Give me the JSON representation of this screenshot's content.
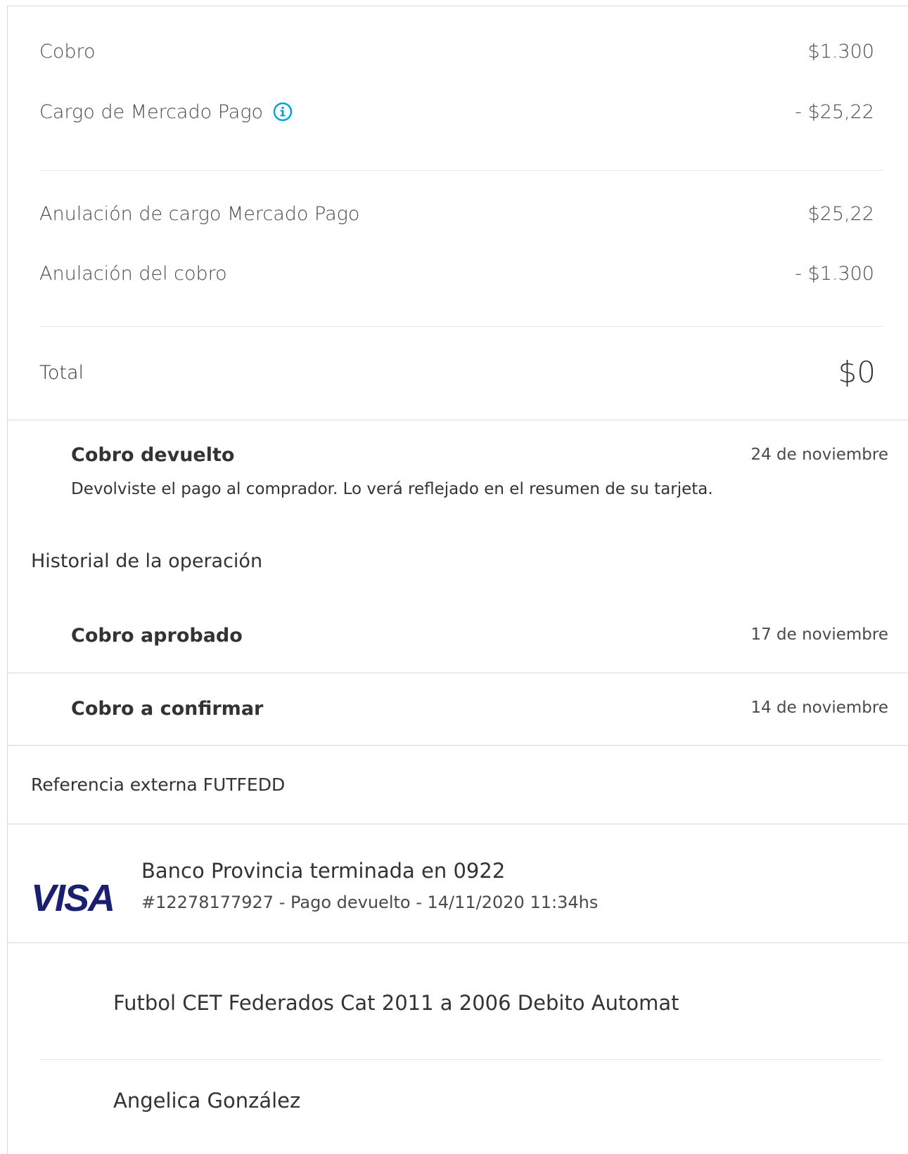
{
  "summary": {
    "rows": [
      {
        "label": "Cobro",
        "amount": "$1.300"
      },
      {
        "label": "Cargo de Mercado Pago",
        "amount": "- $25,22"
      },
      {
        "label": "Anulación de cargo Mercado Pago",
        "amount": "$25,22"
      },
      {
        "label": "Anulación del cobro",
        "amount": "- $1.300"
      }
    ],
    "total_label": "Total",
    "total_amount": "$0"
  },
  "status": {
    "title": "Cobro devuelto",
    "date": "24 de noviembre",
    "description": "Devolviste el pago al comprador. Lo verá reflejado en el resumen de su tarjeta."
  },
  "history": {
    "heading": "Historial de la operación",
    "items": [
      {
        "title": "Cobro aprobado",
        "date": "17 de noviembre"
      },
      {
        "title": "Cobro a confirmar",
        "date": "14 de noviembre"
      }
    ]
  },
  "reference": {
    "text": "Referencia externa FUTFEDD"
  },
  "payment_method": {
    "brand_icon": "visa-logo",
    "card_text": "Banco Provincia terminada en 0922",
    "detail_text": "#12278177927 - Pago devuelto - 14/11/2020 11:34hs"
  },
  "details": {
    "description": "Futbol CET Federados Cat 2011 a 2006 Debito Automat",
    "payer": "Angelica González"
  },
  "colors": {
    "info_icon": "#009ee3",
    "visa_blue": "#1a1f71",
    "divider": "#d9d9d9"
  }
}
